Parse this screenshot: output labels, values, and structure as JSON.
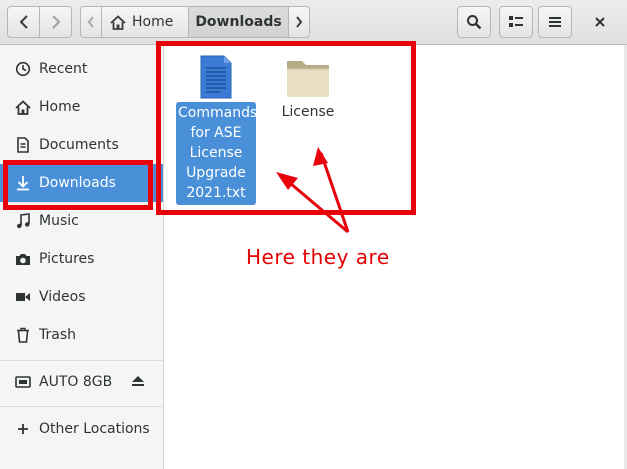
{
  "window": {
    "title": "Downloads"
  },
  "toolbar": {
    "back_icon": "chevron-left-icon",
    "forward_icon": "chevron-right-icon",
    "search_icon": "search-icon",
    "view_icon": "view-options-icon",
    "menu_icon": "hamburger-menu-icon",
    "close_icon": "close-icon"
  },
  "pathbar": {
    "home_label": "Home",
    "current_label": "Downloads"
  },
  "sidebar": {
    "items": [
      {
        "label": "Recent",
        "icon": "clock-icon"
      },
      {
        "label": "Home",
        "icon": "home-icon"
      },
      {
        "label": "Documents",
        "icon": "document-icon"
      },
      {
        "label": "Downloads",
        "icon": "download-icon",
        "selected": true
      },
      {
        "label": "Music",
        "icon": "music-icon"
      },
      {
        "label": "Pictures",
        "icon": "camera-icon"
      },
      {
        "label": "Videos",
        "icon": "video-icon"
      },
      {
        "label": "Trash",
        "icon": "trash-icon"
      }
    ],
    "devices": [
      {
        "label": "AUTO 8GB",
        "icon": "drive-icon",
        "action_icon": "eject-icon"
      }
    ],
    "other": {
      "label": "Other Locations",
      "icon": "plus-icon"
    }
  },
  "files": [
    {
      "name": "Commands for ASE License Upgrade 2021.txt",
      "lines": [
        "Commands",
        "for ASE",
        "License",
        "Upgrade",
        "2021.txt"
      ],
      "type": "text-file-icon",
      "selected": true
    },
    {
      "name": "License",
      "type": "folder-icon",
      "selected": false
    }
  ],
  "annotation": {
    "text": "Here they are",
    "color": "#e8000b"
  },
  "colors": {
    "accent": "#4a90d9",
    "annotation_red": "#e8000b",
    "folder": "#d4c9a8",
    "text_file": "#3a7bd5"
  }
}
